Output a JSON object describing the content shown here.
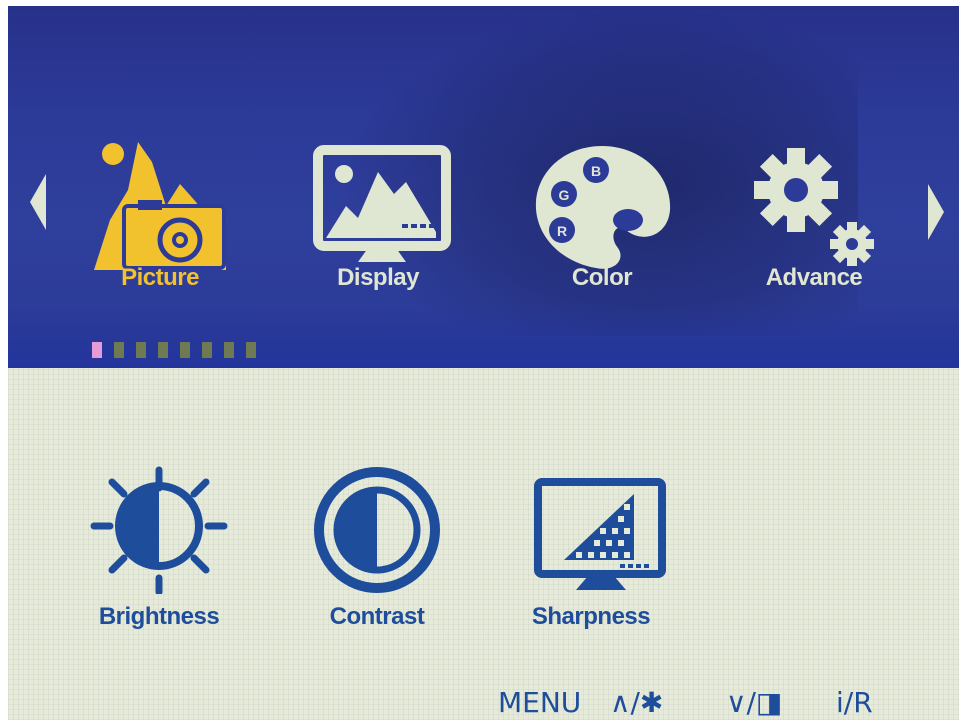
{
  "nav": {
    "left_arrow_icon": "triangle-left",
    "right_arrow_icon": "triangle-right",
    "tabs": [
      {
        "label": "Picture",
        "icon": "picture-mountain-camera",
        "active": true
      },
      {
        "label": "Display",
        "icon": "display-monitor-landscape",
        "active": false
      },
      {
        "label": "Color",
        "icon": "color-palette-rgb",
        "active": false
      },
      {
        "label": "Advance",
        "icon": "advance-gears",
        "active": false
      }
    ],
    "palette_letters": {
      "b": "B",
      "g": "G",
      "r": "R"
    },
    "page_count": 8,
    "page_active": 1
  },
  "submenu": {
    "items": [
      {
        "label": "Brightness",
        "icon": "brightness-sun"
      },
      {
        "label": "Contrast",
        "icon": "contrast-circle"
      },
      {
        "label": "Sharpness",
        "icon": "sharpness-monitor"
      }
    ]
  },
  "keys": {
    "menu": "MENU",
    "up_brightness": "∧/✱",
    "down_volume": "∨/◨",
    "info_reset": "i/R"
  },
  "colors": {
    "header_blue": "#2c3a98",
    "active_yellow": "#f2c12e",
    "inactive_icon": "#dfe6d2",
    "submenu_blue": "#1d4d9b",
    "submenu_bg": "#e6ead8",
    "page_dot": "#6e7a52",
    "page_dot_active": "#e49bd6"
  }
}
